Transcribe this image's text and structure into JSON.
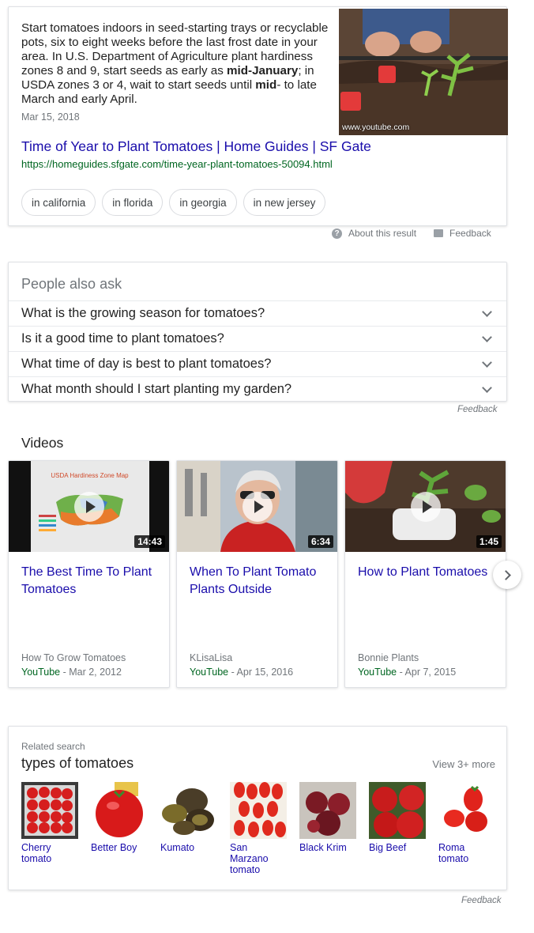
{
  "snippet": {
    "text_parts": [
      {
        "t": "Start tomatoes indoors in seed-starting trays or recyclable pots, six to eight weeks before the last frost date in your area. In U.S. Department of Agriculture plant hardiness zones 8 and 9, start seeds as early as ",
        "b": false
      },
      {
        "t": "mid-January",
        "b": true
      },
      {
        "t": "; in USDA zones 3 or 4, wait to start seeds until ",
        "b": false
      },
      {
        "t": "mid",
        "b": true
      },
      {
        "t": "- to late March and early April.",
        "b": false
      }
    ],
    "date": "Mar 15, 2018",
    "thumbnail_source": "www.youtube.com",
    "title": "Time of Year to Plant Tomatoes | Home Guides | SF Gate",
    "url": "https://homeguides.sfgate.com/time-year-plant-tomatoes-50094.html",
    "chips": [
      "in california",
      "in florida",
      "in georgia",
      "in new jersey"
    ]
  },
  "result_actions": {
    "about": "About this result",
    "feedback": "Feedback"
  },
  "paa": {
    "title": "People also ask",
    "questions": [
      "What is the growing season for tomatoes?",
      "Is it a good time to plant tomatoes?",
      "What time of day is best to plant tomatoes?",
      "What month should I start planting my garden?"
    ],
    "feedback": "Feedback"
  },
  "videos": {
    "heading": "Videos",
    "items": [
      {
        "title": "The Best Time To Plant Tomatoes",
        "duration": "14:43",
        "channel": "How To Grow Tomatoes",
        "source": "YouTube",
        "date": " - Mar 2, 2012",
        "thumb_text": "USDA Hardiness Zone Map"
      },
      {
        "title": "When To Plant Tomato Plants Outside",
        "duration": "6:34",
        "channel": "KLisaLisa",
        "source": "YouTube",
        "date": " - Apr 15, 2016"
      },
      {
        "title": "How to Plant Tomatoes",
        "duration": "1:45",
        "channel": "Bonnie Plants",
        "source": "YouTube",
        "date": " - Apr 7, 2015"
      }
    ]
  },
  "related": {
    "label": "Related search",
    "title": "types of tomatoes",
    "view_more": "View 3+ more",
    "items": [
      "Cherry tomato",
      "Better Boy",
      "Kumato",
      "San Marzano tomato",
      "Black Krim",
      "Big Beef",
      "Roma tomato"
    ],
    "feedback": "Feedback"
  },
  "colors": {
    "link": "#1a0dab",
    "url_green": "#006621",
    "muted": "#70757a"
  }
}
